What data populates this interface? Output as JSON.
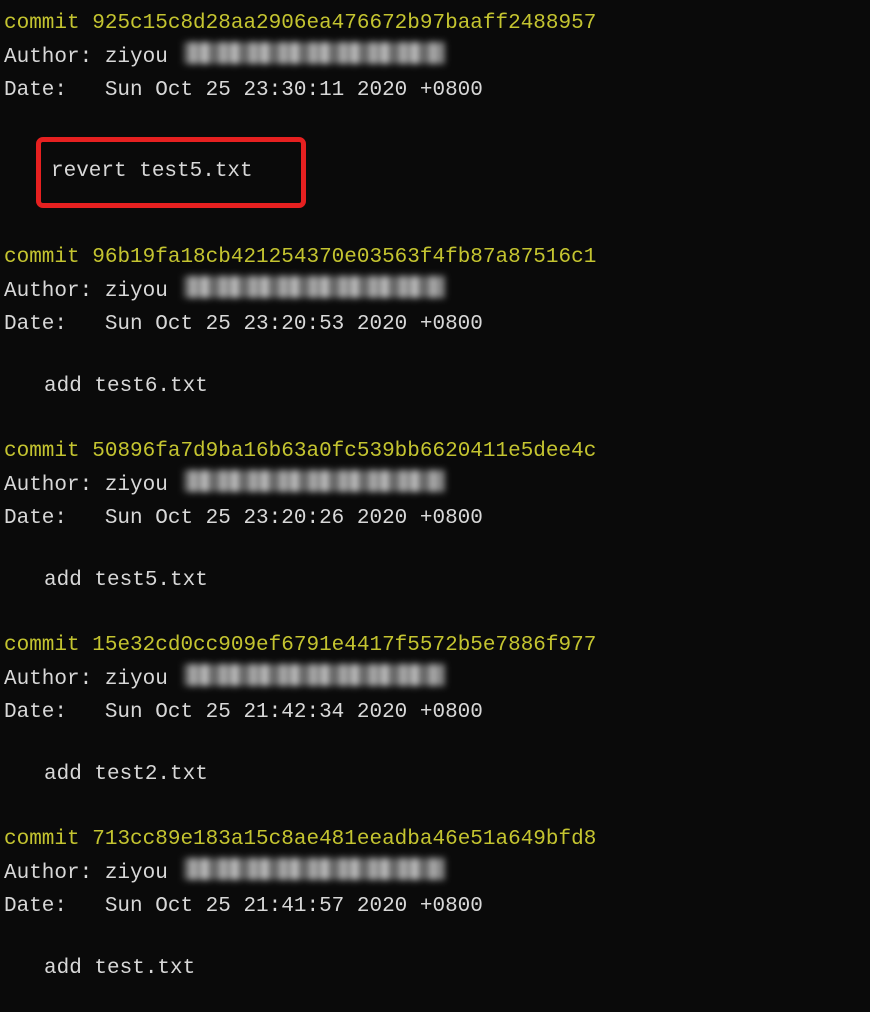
{
  "labels": {
    "commit": "commit",
    "author": "Author:",
    "date": "Date:"
  },
  "commits": [
    {
      "hash": "925c15c8d28aa2906ea476672b97baaff2488957",
      "author_name": "ziyou",
      "date": "Sun Oct 25 23:30:11 2020 +0800",
      "message": "revert test5.txt",
      "highlight": true
    },
    {
      "hash": "96b19fa18cb421254370e03563f4fb87a87516c1",
      "author_name": "ziyou",
      "date": "Sun Oct 25 23:20:53 2020 +0800",
      "message": "add test6.txt",
      "highlight": false
    },
    {
      "hash": "50896fa7d9ba16b63a0fc539bb6620411e5dee4c",
      "author_name": "ziyou",
      "date": "Sun Oct 25 23:20:26 2020 +0800",
      "message": "add test5.txt",
      "highlight": false
    },
    {
      "hash": "15e32cd0cc909ef6791e4417f5572b5e7886f977",
      "author_name": "ziyou",
      "date": "Sun Oct 25 21:42:34 2020 +0800",
      "message": "add test2.txt",
      "highlight": false
    },
    {
      "hash": "713cc89e183a15c8ae481eeadba46e51a649bfd8",
      "author_name": "ziyou",
      "date": "Sun Oct 25 21:41:57 2020 +0800",
      "message": "add test.txt",
      "highlight": false
    }
  ]
}
